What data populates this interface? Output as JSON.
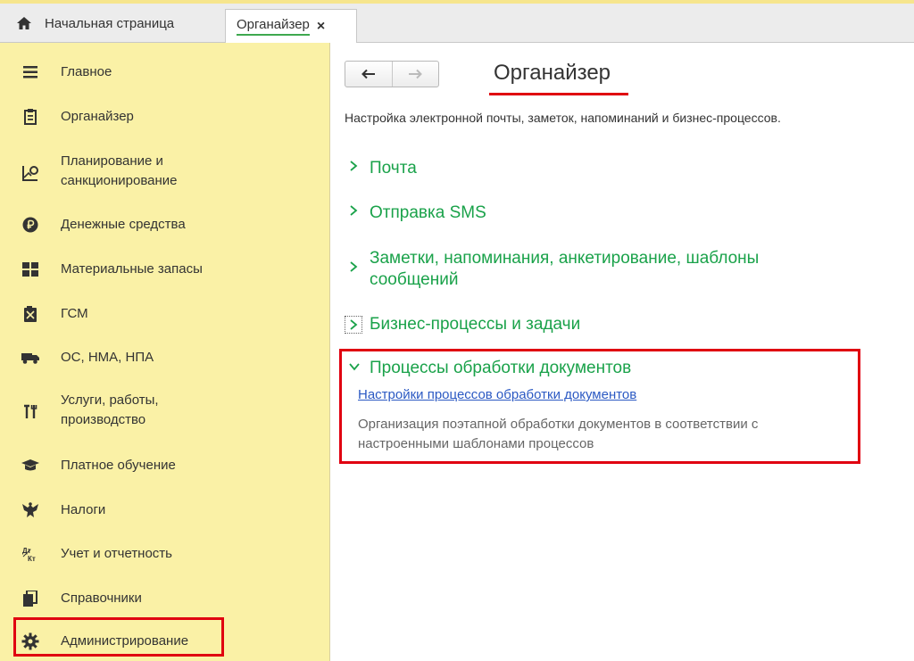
{
  "tabs": {
    "home_label": "Начальная страница",
    "home_icon": "home-icon",
    "active_label": "Органайзер",
    "close_glyph": "×"
  },
  "sidebar": {
    "items": [
      {
        "label": "Главное",
        "icon": "hamburger-icon"
      },
      {
        "label": "Органайзер",
        "icon": "clipboard-icon"
      },
      {
        "label": "Планирование и\nсанкционирование",
        "icon": "chart-plan-icon"
      },
      {
        "label": "Денежные средства",
        "icon": "ruble-icon"
      },
      {
        "label": "Материальные запасы",
        "icon": "warehouse-icon"
      },
      {
        "label": "ГСМ",
        "icon": "fuel-icon"
      },
      {
        "label": "ОС, НМА, НПА",
        "icon": "truck-icon"
      },
      {
        "label": "Услуги, работы,\nпроизводство",
        "icon": "tools-icon"
      },
      {
        "label": "Платное обучение",
        "icon": "graduation-cap-icon"
      },
      {
        "label": "Налоги",
        "icon": "eagle-emblem-icon"
      },
      {
        "label": "Учет и отчетность",
        "icon": "debit-credit-icon"
      },
      {
        "label": "Справочники",
        "icon": "books-icon"
      },
      {
        "label": "Администрирование",
        "icon": "gear-icon"
      }
    ],
    "highlight_color": "#e00010",
    "background": "#faf1a6"
  },
  "main": {
    "back_glyph": "🡐",
    "forward_glyph": "🡒",
    "title": "Органайзер",
    "subtitle": "Настройка электронной почты, заметок, напоминаний и бизнес-процессов.",
    "groups": [
      {
        "label": "Почта",
        "expanded": false
      },
      {
        "label": "Отправка SMS",
        "expanded": false
      },
      {
        "label": "Заметки, напоминания, анкетирование, шаблоны\nсообщений",
        "expanded": false
      },
      {
        "label": "Бизнес-процессы и задачи",
        "expanded": false,
        "focused": true
      },
      {
        "label": "Процессы обработки документов",
        "expanded": true
      }
    ],
    "process_link": "Настройки процессов обработки документов",
    "process_desc": "Организация поэтапной обработки документов в соответствии с\nнастроенными шаблонами процессов",
    "accent_color": "#1aa24a",
    "link_color": "#2b59c3"
  }
}
